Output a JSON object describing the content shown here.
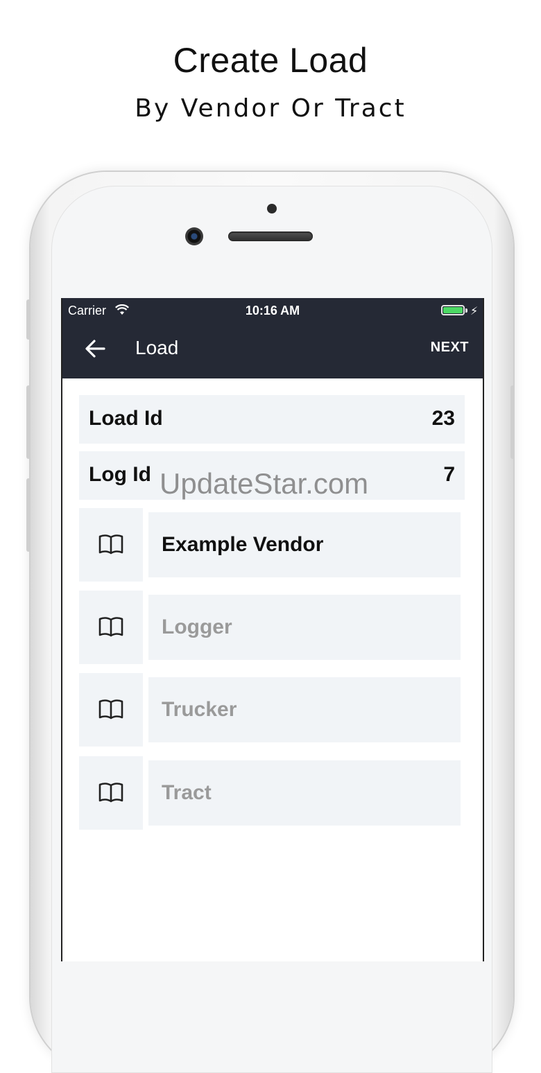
{
  "promo": {
    "title": "Create Load",
    "subtitle": "By Vendor Or Tract"
  },
  "status_bar": {
    "carrier": "Carrier",
    "time": "10:16 AM"
  },
  "app_bar": {
    "title": "Load",
    "next_label": "NEXT"
  },
  "fields": {
    "load_id": {
      "label": "Load Id",
      "value": "23"
    },
    "log_id": {
      "label": "Log Id",
      "value": "7"
    }
  },
  "pickers": [
    {
      "text": "Example Vendor",
      "filled": true,
      "icon": "book-icon"
    },
    {
      "text": "Logger",
      "filled": false,
      "icon": "book-icon"
    },
    {
      "text": "Trucker",
      "filled": false,
      "icon": "book-icon"
    },
    {
      "text": "Tract",
      "filled": false,
      "icon": "book-icon"
    }
  ],
  "watermark": "UpdateStar.com",
  "colors": {
    "app_bar": "#252935",
    "row_background": "#f1f4f7",
    "placeholder_text": "#9a9a9a",
    "battery": "#4cd964"
  }
}
